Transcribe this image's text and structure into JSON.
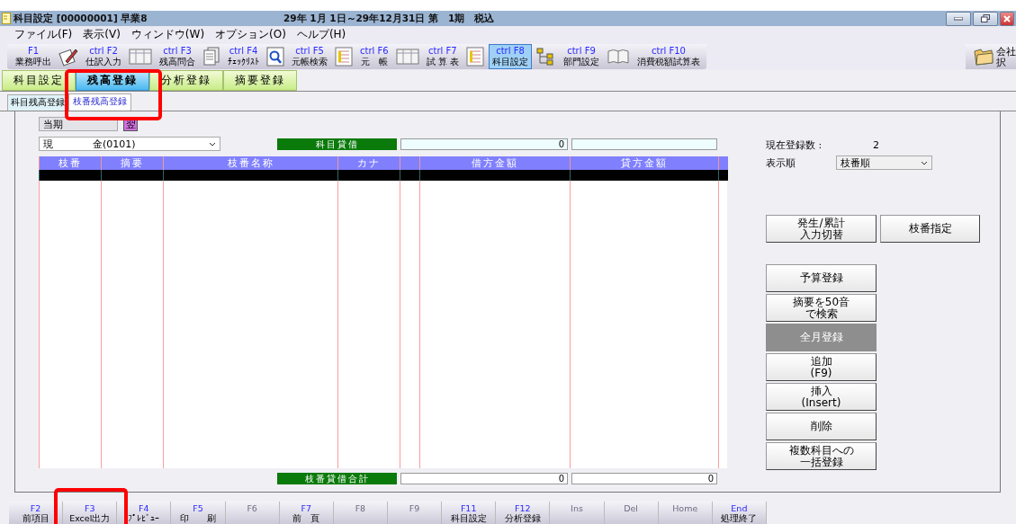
{
  "window": {
    "title": "科目設定 [00000001] 早業8",
    "period": "29年 1月 1日～29年12月31日 第　1期　税込"
  },
  "menu": [
    "ファイル(F)",
    "表示(V)",
    "ウィンドウ(W)",
    "オプション(O)",
    "ヘルプ(H)"
  ],
  "toolbar": [
    {
      "key": "F1",
      "label": "業務呼出",
      "selected": false
    },
    {
      "key": "ctrl F2",
      "label": "仕訳入力",
      "selected": false
    },
    {
      "key": "ctrl F3",
      "label": "残高問合",
      "selected": false
    },
    {
      "key": "ctrl F4",
      "label": "ﾁｪｯｸﾘｽﾄ",
      "selected": false
    },
    {
      "key": "ctrl F5",
      "label": "元帳検索",
      "selected": false
    },
    {
      "key": "ctrl F6",
      "label": "元　帳",
      "selected": false
    },
    {
      "key": "ctrl F7",
      "label": "試 算 表",
      "selected": false
    },
    {
      "key": "ctrl F8",
      "label": "科目設定",
      "selected": true
    },
    {
      "key": "ctrl F9",
      "label": "部門設定",
      "selected": false
    },
    {
      "key": "ctrl F10",
      "label": "消費税額試算表",
      "selected": false
    }
  ],
  "company_button": {
    "line_1": "会社",
    "line_2": "択"
  },
  "tabs": [
    {
      "label": "科目設定",
      "selected": false
    },
    {
      "label": "残高登録",
      "selected": true
    },
    {
      "label": "分析登録",
      "selected": false
    },
    {
      "label": "摘要登録",
      "selected": false
    }
  ],
  "subtabs": [
    {
      "label": "科目残高登録",
      "selected": false
    },
    {
      "label": "枝番残高登録",
      "selected": true
    }
  ],
  "period_select": {
    "value": "当期"
  },
  "next_button": "翌",
  "account_select": {
    "value": "現　　　　金(0101)"
  },
  "balance": {
    "label": "科目貸借",
    "debit": "0"
  },
  "registered": {
    "label": "現在登録数 :",
    "value": "2"
  },
  "sort": {
    "label": "表示順",
    "value": "枝番順"
  },
  "table": {
    "columns": [
      "枝番",
      "摘要",
      "枝番名称",
      "カナ",
      "",
      "借方金額",
      "貸方金額",
      ""
    ]
  },
  "total": {
    "label": "枝番貸借合計",
    "debit": "0",
    "credit": "0"
  },
  "top_buttons": [
    [
      "発生/累計",
      "入力切替"
    ],
    [
      "枝番指定"
    ]
  ],
  "side_buttons": [
    {
      "lines": [
        "予算登録"
      ],
      "disabled": false
    },
    {
      "lines": [
        "摘要を50音",
        "で検索"
      ],
      "disabled": false
    },
    {
      "lines": [
        "全月登録"
      ],
      "disabled": true
    },
    {
      "lines": [
        "追加",
        "(F9)"
      ],
      "disabled": false
    },
    {
      "lines": [
        "挿入",
        "(Insert)"
      ],
      "disabled": false
    },
    {
      "lines": [
        "削除"
      ],
      "disabled": false
    },
    {
      "lines": [
        "複数科目への",
        "一括登録"
      ],
      "disabled": false
    }
  ],
  "fkeys": [
    {
      "key": "F2",
      "label": "前項目",
      "disabled": false
    },
    {
      "key": "F3",
      "label": "Excel出力",
      "disabled": false
    },
    {
      "key": "F4",
      "label": "ﾌﾟﾚﾋﾞｭｰ",
      "disabled": false
    },
    {
      "key": "F5",
      "label": "印　　刷",
      "disabled": false
    },
    {
      "key": "F6",
      "disabled": true
    },
    {
      "key": "F7",
      "label": "前　頁",
      "disabled": false
    },
    {
      "key": "F8",
      "disabled": true
    },
    {
      "key": "F9",
      "disabled": true
    },
    {
      "key": "F11",
      "label": "科目設定",
      "disabled": false
    },
    {
      "key": "F12",
      "label": "分析登録",
      "disabled": false
    },
    {
      "key": "Ins",
      "disabled": true
    },
    {
      "key": "Del",
      "disabled": true
    },
    {
      "key": "Home",
      "disabled": true
    },
    {
      "key": "End",
      "label": "処理終了",
      "disabled": false
    }
  ]
}
